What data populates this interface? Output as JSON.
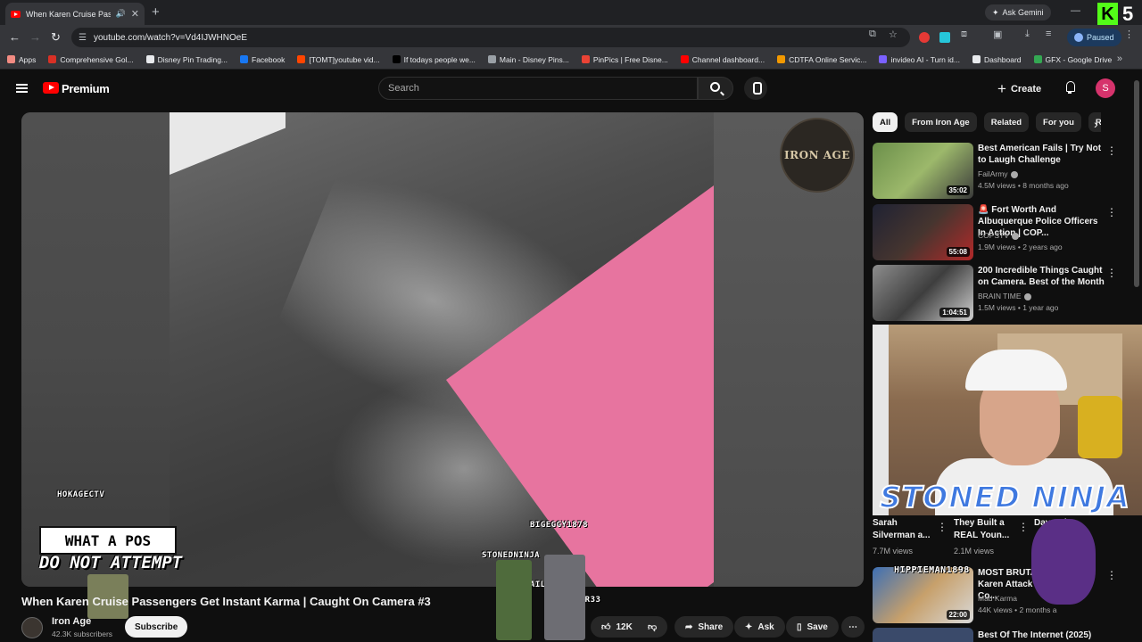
{
  "browser": {
    "tab_title": "When Karen Cruise Passeng",
    "ask_gemini": "Ask Gemini",
    "url": "youtube.com/watch?v=Vd4IJWHNOeE",
    "profile_status": "Paused",
    "bookmarks": [
      {
        "label": "Apps",
        "color": "#f28b82"
      },
      {
        "label": "Comprehensive Gol...",
        "color": "#d93025"
      },
      {
        "label": "Disney Pin Trading...",
        "color": "#e8eaed"
      },
      {
        "label": "Facebook",
        "color": "#1877f2"
      },
      {
        "label": "[TOMT]youtube vid...",
        "color": "#ff4500"
      },
      {
        "label": "If todays people we...",
        "color": "#000000"
      },
      {
        "label": "Main - Disney Pins...",
        "color": "#9aa0a6"
      },
      {
        "label": "PinPics | Free Disne...",
        "color": "#ea4335"
      },
      {
        "label": "Channel dashboard...",
        "color": "#ff0000"
      },
      {
        "label": "CDTFA Online Servic...",
        "color": "#f29900"
      },
      {
        "label": "invideo AI - Turn id...",
        "color": "#7b61ff"
      },
      {
        "label": "Dashboard",
        "color": "#e8eaed"
      },
      {
        "label": "GFX - Google Drive",
        "color": "#34a853"
      }
    ]
  },
  "masthead": {
    "brand": "Premium",
    "search_placeholder": "Search",
    "create_label": "Create",
    "avatar_letter": "S"
  },
  "player": {
    "watermark": "IRON AGE",
    "overlay_users": [
      "HOKAGECTV",
      "BIGEGGY1878",
      "STONEDNINJA",
      "NAILBEATER",
      "JAHFR33"
    ],
    "alert_top": "WHAT A POS",
    "alert_bottom": "DO NOT ATTEMPT"
  },
  "video": {
    "title": "When Karen Cruise Passengers Get Instant Karma | Caught On Camera #3",
    "channel": "Iron Age",
    "subscribers": "42.3K subscribers",
    "subscribe_label": "Subscribe",
    "likes": "12K",
    "share_label": "Share",
    "ask_label": "Ask",
    "save_label": "Save"
  },
  "chips": [
    "All",
    "From Iron Age",
    "Related",
    "For you",
    "Recently uploaded"
  ],
  "recommendations": [
    {
      "title": "Best American Fails | Try Not to Laugh Challenge",
      "channel": "FailArmy",
      "meta": "4.5M views • 8 months ago",
      "duration": "35:02"
    },
    {
      "title": "🚨 Fort Worth And Albuquerque Police Officers In Action | COP...",
      "channel": "COPSTV",
      "meta": "1.9M views • 2 years ago",
      "duration": "55:08"
    },
    {
      "title": "200 Incredible Things Caught on Camera. Best of the Month",
      "channel": "BRAIN TIME",
      "meta": "1.5M views • 1 year ago",
      "duration": "1:04:51"
    },
    {
      "title": "MOST BRUTAL Karen Attack Co...",
      "channel": "Mad Karma",
      "meta": "44K views • 2 months a",
      "duration": "22:00"
    },
    {
      "title": "Best Of The Internet (2025)",
      "channel": "",
      "meta": "",
      "duration": ""
    }
  ],
  "shorts": [
    {
      "title": "Sarah Silverman a...",
      "views": "7.7M views"
    },
    {
      "title": "They Built a REAL Youn...",
      "views": "2.1M views"
    },
    {
      "title": "Dave Ch...",
      "views": ""
    }
  ],
  "stream_overlay": {
    "cam_label": "STONED NINJA",
    "viewer_name": "HIPPIEMAN1898"
  }
}
